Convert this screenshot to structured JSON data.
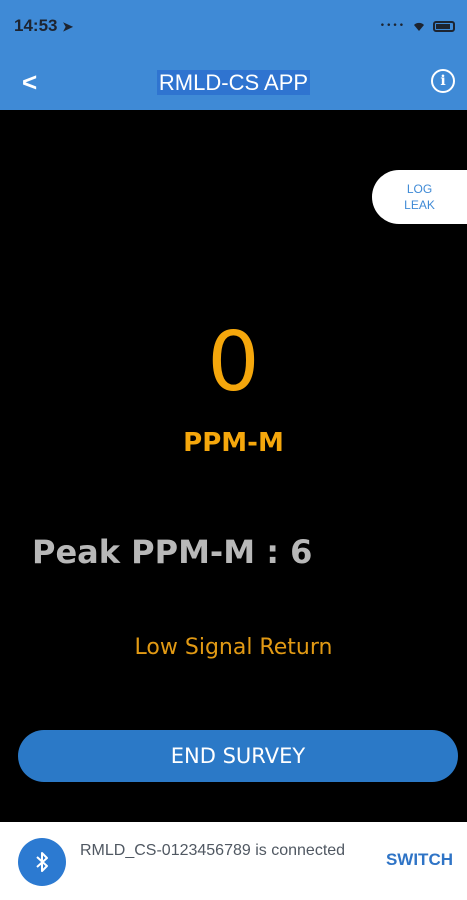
{
  "status_bar": {
    "time": "14:53",
    "location_icon": "location-arrow-icon",
    "signal_icon": "signal-dots-icon",
    "wifi_icon": "wifi-icon",
    "battery_icon": "battery-icon"
  },
  "nav": {
    "back_label": "<",
    "title": "RMLD-CS APP",
    "info_icon": "info-icon",
    "info_glyph": "i"
  },
  "main": {
    "log_leak_line1": "LOG",
    "log_leak_line2": "LEAK",
    "ppm_value": "0",
    "ppm_unit": "PPM-M",
    "peak_label": "Peak PPM-M",
    "peak_separator": ":",
    "peak_value": "6",
    "signal_status": "Low Signal Return",
    "end_survey_label": "END SURVEY"
  },
  "footer": {
    "bluetooth_icon": "bluetooth-icon",
    "connection_text": "RMLD_CS-0123456789 is connected",
    "switch_label": "SWITCH"
  },
  "colors": {
    "header_blue": "#3f8ad6",
    "reading_orange": "#f5a70c",
    "button_blue": "#2b79c7",
    "background_black": "#000000"
  }
}
